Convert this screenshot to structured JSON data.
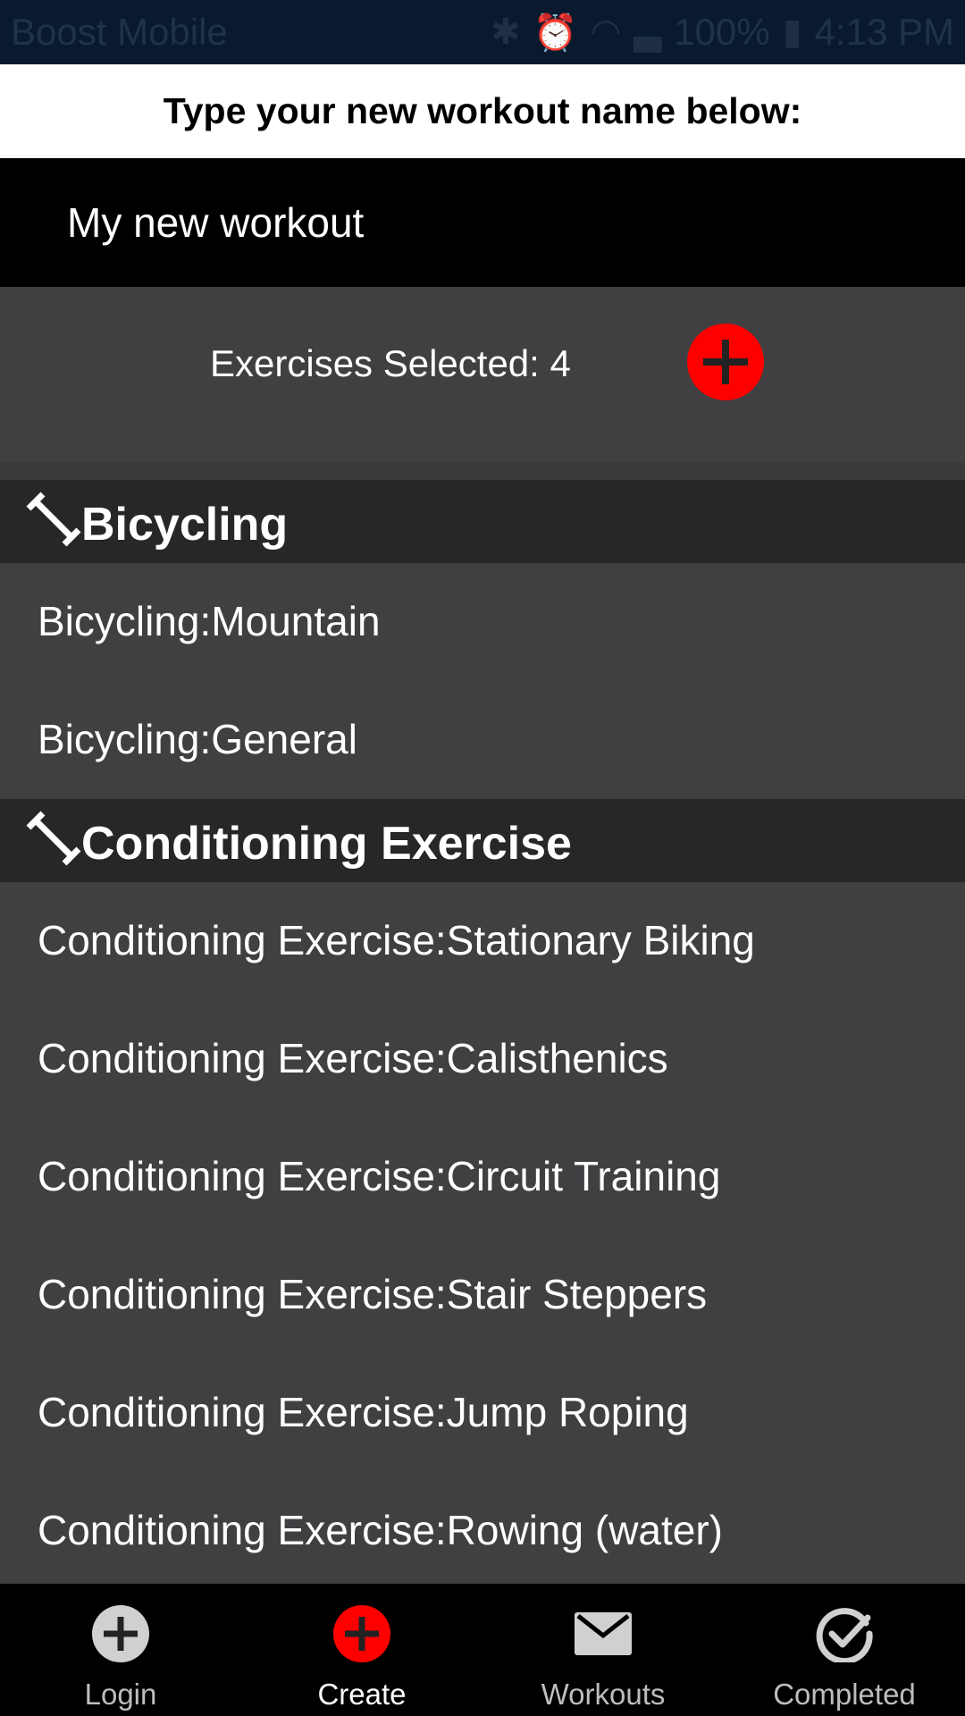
{
  "status_bar": {
    "carrier": "Boost Mobile",
    "battery": "100%",
    "time": "4:13 PM"
  },
  "header": {
    "title": "Type your new workout name below:"
  },
  "workout_name_input": {
    "value": "My new workout"
  },
  "selection": {
    "text": "Exercises Selected: 4"
  },
  "sections": [
    {
      "title": "Bicycling",
      "items": [
        "Bicycling:Mountain",
        "Bicycling:General"
      ]
    },
    {
      "title": "Conditioning Exercise",
      "items": [
        "Conditioning Exercise:Stationary Biking",
        "Conditioning Exercise:Calisthenics",
        "Conditioning Exercise:Circuit Training",
        "Conditioning Exercise:Stair Steppers",
        "Conditioning Exercise:Jump Roping",
        "Conditioning Exercise:Rowing (water)"
      ]
    }
  ],
  "bottom_nav": [
    {
      "label": "Login",
      "icon": "plus-circle-icon",
      "active": false
    },
    {
      "label": "Create",
      "icon": "plus-circle-icon",
      "active": true
    },
    {
      "label": "Workouts",
      "icon": "envelope-icon",
      "active": false
    },
    {
      "label": "Completed",
      "icon": "check-circle-icon",
      "active": false
    }
  ],
  "colors": {
    "accent": "#ff0000",
    "background": "#404043",
    "section_header": "#272727",
    "nav_background": "#000000"
  }
}
